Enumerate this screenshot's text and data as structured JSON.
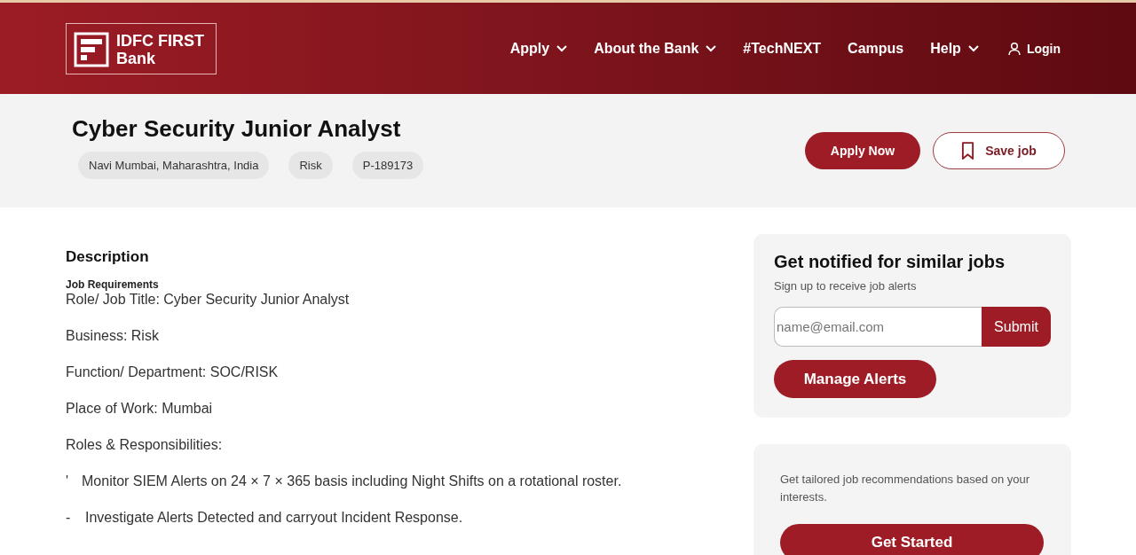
{
  "header": {
    "logo": {
      "line1": "IDFC FIRST",
      "line2": "Bank"
    },
    "nav": [
      {
        "label": "Apply",
        "dropdown": true
      },
      {
        "label": "About the Bank",
        "dropdown": true
      },
      {
        "label": "#TechNEXT",
        "dropdown": false
      },
      {
        "label": "Campus",
        "dropdown": false
      },
      {
        "label": "Help",
        "dropdown": true
      }
    ],
    "login": "Login"
  },
  "job": {
    "title": "Cyber Security Junior Analyst",
    "tags": [
      "Navi Mumbai, Maharashtra, India",
      "Risk",
      "P-189173"
    ],
    "apply_button": "Apply Now",
    "save_button": "Save job"
  },
  "description": {
    "heading": "Description",
    "subheading": "Job Requirements",
    "paragraphs": [
      "Role/ Job Title: Cyber Security Junior Analyst",
      "Business: Risk",
      "Function/ Department: SOC/RISK",
      "Place of Work: Mumbai",
      "Roles & Responsibilities:"
    ],
    "bullets": [
      {
        "marker": "'",
        "text": "Monitor SIEM Alerts on 24 × 7 × 365 basis including Night Shifts on a rotational roster."
      },
      {
        "marker": "-",
        "text": "Investigate Alerts Detected and carryout Incident Response."
      }
    ]
  },
  "alerts_card": {
    "title": "Get notified for similar jobs",
    "subtitle": "Sign up to receive job alerts",
    "email_placeholder": "name@email.com",
    "submit": "Submit",
    "manage": "Manage Alerts"
  },
  "recommend_card": {
    "text": "Get tailored job recommendations based on your interests.",
    "button": "Get Started"
  }
}
